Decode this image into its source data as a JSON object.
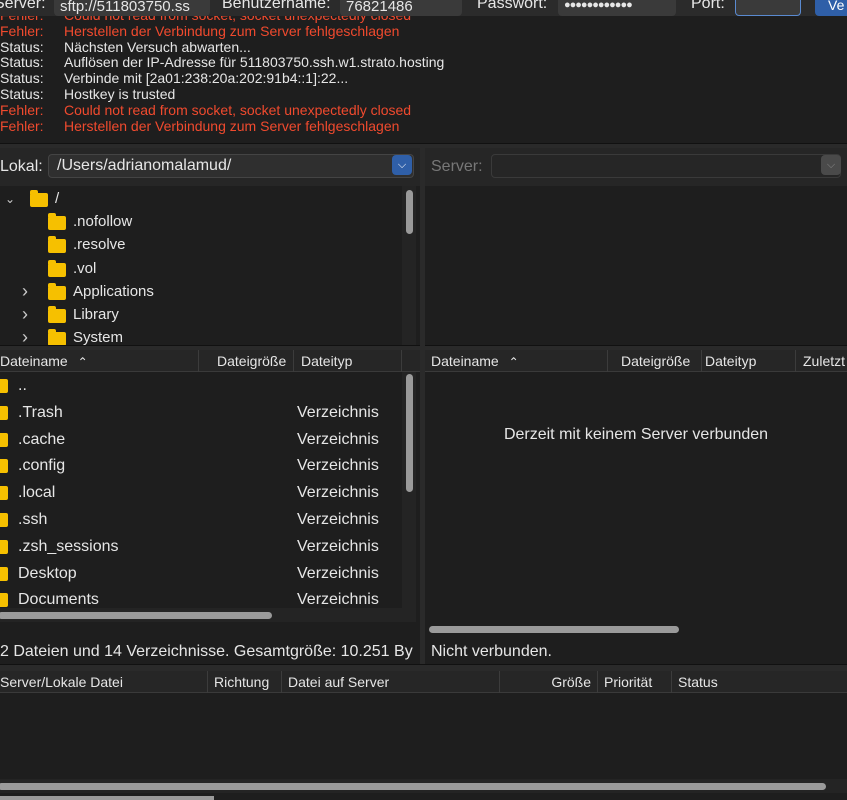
{
  "quickconnect": {
    "server_label": "Server:",
    "server_value": "sftp://511803750.ss",
    "user_label": "Benutzername:",
    "user_value": "76821486",
    "pass_label": "Passwort:",
    "pass_value": "●●●●●●●●●●●●",
    "port_label": "Port:",
    "port_value": "",
    "connect_label": "Ve"
  },
  "log": [
    {
      "type": "Fehler:",
      "msg": "Could not read from socket, socket unexpectedly closed"
    },
    {
      "type": "Fehler:",
      "msg": "Herstellen der Verbindung zum Server fehlgeschlagen"
    },
    {
      "type": "Status:",
      "msg": "Nächsten Versuch abwarten..."
    },
    {
      "type": "Status:",
      "msg": "Auflösen der IP-Adresse für 511803750.ssh.w1.strato.hosting"
    },
    {
      "type": "Status:",
      "msg": "Verbinde mit [2a01:238:20a:202:91b4::1]:22..."
    },
    {
      "type": "Status:",
      "msg": "Hostkey is trusted"
    },
    {
      "type": "Fehler:",
      "msg": "Could not read from socket, socket unexpectedly closed"
    },
    {
      "type": "Fehler:",
      "msg": "Herstellen der Verbindung zum Server fehlgeschlagen"
    }
  ],
  "local": {
    "label": "Lokal:",
    "path": "/Users/adrianomalamud/",
    "tree": [
      {
        "name": "/",
        "expanded": true
      },
      {
        "name": ".nofollow"
      },
      {
        "name": ".resolve"
      },
      {
        "name": ".vol"
      },
      {
        "name": "Applications",
        "collapsed": true
      },
      {
        "name": "Library",
        "collapsed": true
      },
      {
        "name": "System",
        "collapsed": true
      }
    ],
    "columns": [
      "Dateiname",
      "Dateigröße",
      "Dateityp"
    ],
    "files": [
      {
        "name": "..",
        "type": ""
      },
      {
        "name": ".Trash",
        "type": "Verzeichnis"
      },
      {
        "name": ".cache",
        "type": "Verzeichnis"
      },
      {
        "name": ".config",
        "type": "Verzeichnis"
      },
      {
        "name": ".local",
        "type": "Verzeichnis"
      },
      {
        "name": ".ssh",
        "type": "Verzeichnis"
      },
      {
        "name": ".zsh_sessions",
        "type": "Verzeichnis"
      },
      {
        "name": "Desktop",
        "type": "Verzeichnis"
      },
      {
        "name": "Documents",
        "type": "Verzeichnis"
      }
    ],
    "status": "2 Dateien und 14 Verzeichnisse. Gesamtgröße: 10.251 By"
  },
  "remote": {
    "label": "Server:",
    "path": "",
    "columns": [
      "Dateiname",
      "Dateigröße",
      "Dateityp",
      "Zuletzt"
    ],
    "empty_message": "Derzeit mit keinem Server verbunden",
    "status": "Nicht verbunden."
  },
  "queue": {
    "columns": [
      "Server/Lokale Datei",
      "Richtung",
      "Datei auf Server",
      "Größe",
      "Priorität",
      "Status"
    ]
  },
  "colors": {
    "error": "#f04a2e",
    "folder": "#f6c000",
    "accent": "#2f5fa8"
  }
}
